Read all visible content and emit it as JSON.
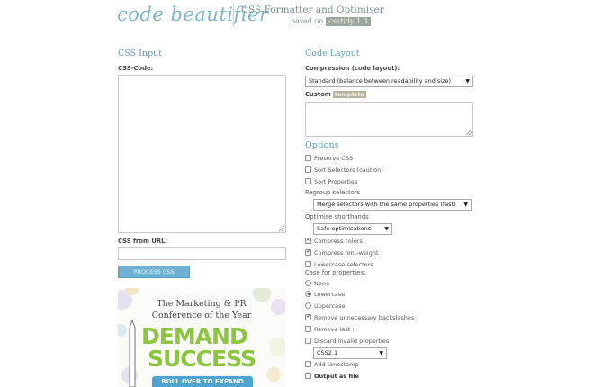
{
  "header": {
    "logo": "code beautifier",
    "subtitle": "CSS Formatter and Optimiser",
    "based_on": "based on",
    "based_on_tag": "csstidy 1.3"
  },
  "left": {
    "section_title": "CSS Input",
    "code_label": "CSS-Code:",
    "url_label": "CSS from URL:",
    "url_value": "",
    "process_button": "PROCESS CSS"
  },
  "ad": {
    "line1": "The Marketing & PR",
    "line2": "Conference of the Year",
    "demand": "DEMAND",
    "success": "SUCCESS",
    "roll": "ROLL OVER TO EXPAND",
    "colors": {
      "green": "#8cc63f",
      "blue": "#4ea4d0"
    }
  },
  "right": {
    "section_title": "Code Layout",
    "compression_label": "Compression (code layout):",
    "compression_value": "Standard (balance between readability and size)",
    "custom_label": "Custom",
    "template_tag": "template",
    "options_title": "Options",
    "preserve_css": "Preserve CSS",
    "sort_selectors": "Sort Selectors (caution)",
    "sort_properties": "Sort Properties",
    "regroup_label": "Regroup selectors",
    "regroup_value": "Merge selectors with the same properties (fast)",
    "optimise_label": "Optimise shorthands",
    "optimise_value": "Safe optimisations",
    "compress_colors": "Compress colors",
    "compress_font_weight": "Compress font-weight",
    "lowercase_selectors": "Lowercase selectors",
    "case_label": "Case for properties:",
    "case_none": "None",
    "case_lowercase": "Lowercase",
    "case_uppercase": "Uppercase",
    "remove_backslashes": "Remove unnecessary backslashes",
    "remove_last": "Remove last ;",
    "discard_invalid": "Discard invalid properties",
    "css_level_value": "CSS2.1",
    "add_timestamp": "Add timestamp",
    "output_as_file": "Output as file"
  },
  "colors": {
    "accent": "#5d9fb4",
    "logo": "#7fb6c8",
    "button": "#6fb0d3"
  }
}
